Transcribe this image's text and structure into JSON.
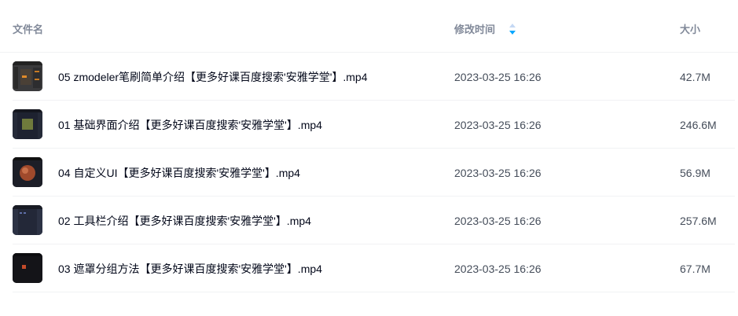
{
  "header": {
    "name_label": "文件名",
    "time_label": "修改时间",
    "size_label": "大小",
    "sort_icon": "sort-descending-icon"
  },
  "colors": {
    "sort_active": "#06a7ff",
    "sort_inactive": "#c4d8f4"
  },
  "files": [
    {
      "name": "05 zmodeler笔刷简单介绍【更多好课百度搜索'安雅学堂'】.mp4",
      "modified": "2023-03-25 16:26",
      "size": "42.7M",
      "thumbnail": "video-thumbnail"
    },
    {
      "name": "01 基础界面介绍【更多好课百度搜索'安雅学堂'】.mp4",
      "modified": "2023-03-25 16:26",
      "size": "246.6M",
      "thumbnail": "video-thumbnail"
    },
    {
      "name": "04 自定义UI【更多好课百度搜索'安雅学堂'】.mp4",
      "modified": "2023-03-25 16:26",
      "size": "56.9M",
      "thumbnail": "video-thumbnail"
    },
    {
      "name": "02 工具栏介绍【更多好课百度搜索'安雅学堂'】.mp4",
      "modified": "2023-03-25 16:26",
      "size": "257.6M",
      "thumbnail": "video-thumbnail"
    },
    {
      "name": "03 遮罩分组方法【更多好课百度搜索'安雅学堂'】.mp4",
      "modified": "2023-03-25 16:26",
      "size": "67.7M",
      "thumbnail": "video-thumbnail"
    }
  ]
}
